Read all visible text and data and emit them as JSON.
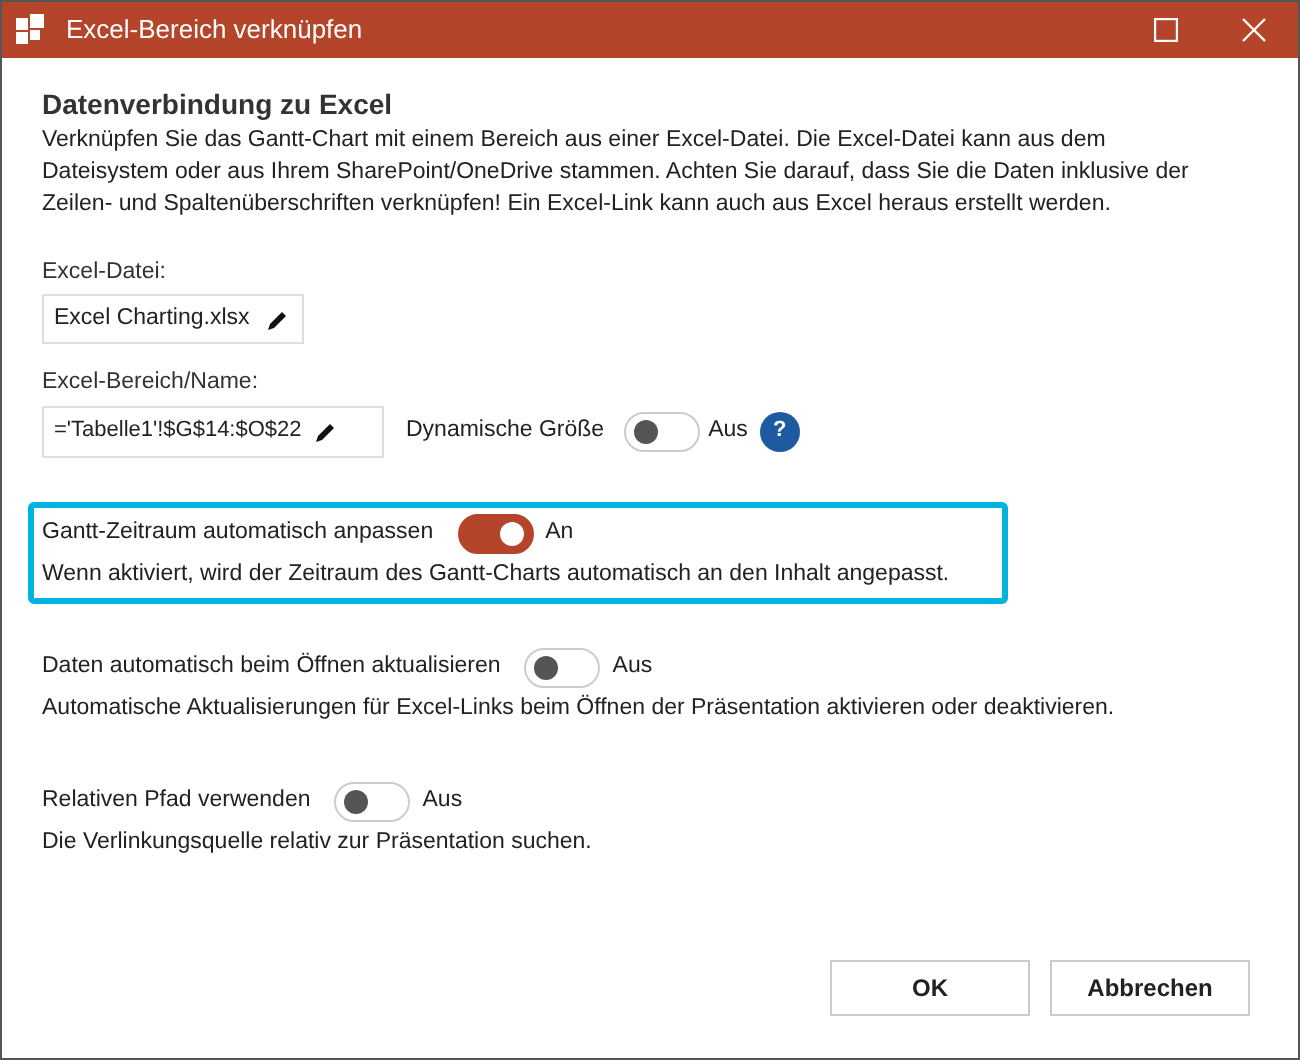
{
  "window": {
    "title": "Excel-Bereich verknüpfen"
  },
  "heading": "Datenverbindung zu Excel",
  "description": "Verknüpfen Sie das Gantt-Chart mit einem Bereich aus einer Excel-Datei. Die Excel-Datei kann aus dem Dateisystem oder aus Ihrem SharePoint/OneDrive stammen. Achten Sie darauf, dass Sie die Daten inklusive der Zeilen- und Spaltenüberschriften verknüpfen! Ein Excel-Link kann auch aus Excel heraus erstellt werden.",
  "file_field": {
    "label": "Excel-Datei:",
    "value": "Excel Charting.xlsx"
  },
  "range_field": {
    "label": "Excel-Bereich/Name:",
    "value": "='Tabelle1'!$G$14:$O$22",
    "dynamic_size": {
      "label": "Dynamische Größe",
      "on": false,
      "state_text": "Aus",
      "help": "?"
    }
  },
  "options": [
    {
      "label": "Gantt-Zeitraum automatisch anpassen",
      "on": true,
      "state_text": "An",
      "description": "Wenn aktiviert, wird der Zeitraum des Gantt-Charts automatisch an den Inhalt angepasst.",
      "highlighted": true
    },
    {
      "label": "Daten automatisch beim Öffnen aktualisieren",
      "on": false,
      "state_text": "Aus",
      "description": "Automatische Aktualisierungen für Excel-Links beim Öffnen der Präsentation aktivieren oder deaktivieren.",
      "highlighted": false
    },
    {
      "label": "Relativen Pfad verwenden",
      "on": false,
      "state_text": "Aus",
      "description": "Die Verlinkungsquelle relativ zur Präsentation suchen.",
      "highlighted": false
    }
  ],
  "buttons": [
    {
      "label": "OK"
    },
    {
      "label": "Abbrechen"
    }
  ]
}
